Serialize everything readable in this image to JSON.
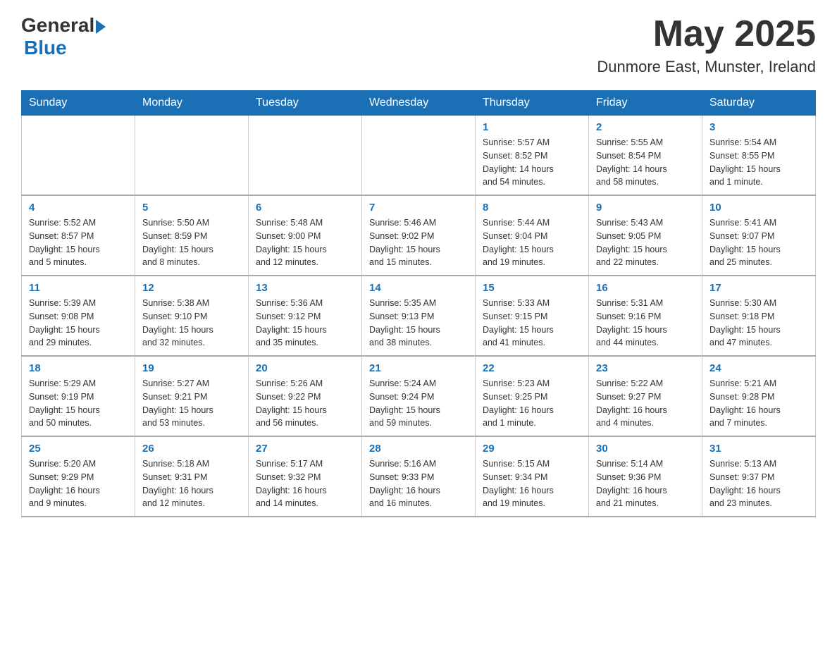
{
  "header": {
    "logo_general": "General",
    "logo_blue": "Blue",
    "month": "May 2025",
    "location": "Dunmore East, Munster, Ireland"
  },
  "weekdays": [
    "Sunday",
    "Monday",
    "Tuesday",
    "Wednesday",
    "Thursday",
    "Friday",
    "Saturday"
  ],
  "weeks": [
    [
      {
        "day": "",
        "info": ""
      },
      {
        "day": "",
        "info": ""
      },
      {
        "day": "",
        "info": ""
      },
      {
        "day": "",
        "info": ""
      },
      {
        "day": "1",
        "info": "Sunrise: 5:57 AM\nSunset: 8:52 PM\nDaylight: 14 hours\nand 54 minutes."
      },
      {
        "day": "2",
        "info": "Sunrise: 5:55 AM\nSunset: 8:54 PM\nDaylight: 14 hours\nand 58 minutes."
      },
      {
        "day": "3",
        "info": "Sunrise: 5:54 AM\nSunset: 8:55 PM\nDaylight: 15 hours\nand 1 minute."
      }
    ],
    [
      {
        "day": "4",
        "info": "Sunrise: 5:52 AM\nSunset: 8:57 PM\nDaylight: 15 hours\nand 5 minutes."
      },
      {
        "day": "5",
        "info": "Sunrise: 5:50 AM\nSunset: 8:59 PM\nDaylight: 15 hours\nand 8 minutes."
      },
      {
        "day": "6",
        "info": "Sunrise: 5:48 AM\nSunset: 9:00 PM\nDaylight: 15 hours\nand 12 minutes."
      },
      {
        "day": "7",
        "info": "Sunrise: 5:46 AM\nSunset: 9:02 PM\nDaylight: 15 hours\nand 15 minutes."
      },
      {
        "day": "8",
        "info": "Sunrise: 5:44 AM\nSunset: 9:04 PM\nDaylight: 15 hours\nand 19 minutes."
      },
      {
        "day": "9",
        "info": "Sunrise: 5:43 AM\nSunset: 9:05 PM\nDaylight: 15 hours\nand 22 minutes."
      },
      {
        "day": "10",
        "info": "Sunrise: 5:41 AM\nSunset: 9:07 PM\nDaylight: 15 hours\nand 25 minutes."
      }
    ],
    [
      {
        "day": "11",
        "info": "Sunrise: 5:39 AM\nSunset: 9:08 PM\nDaylight: 15 hours\nand 29 minutes."
      },
      {
        "day": "12",
        "info": "Sunrise: 5:38 AM\nSunset: 9:10 PM\nDaylight: 15 hours\nand 32 minutes."
      },
      {
        "day": "13",
        "info": "Sunrise: 5:36 AM\nSunset: 9:12 PM\nDaylight: 15 hours\nand 35 minutes."
      },
      {
        "day": "14",
        "info": "Sunrise: 5:35 AM\nSunset: 9:13 PM\nDaylight: 15 hours\nand 38 minutes."
      },
      {
        "day": "15",
        "info": "Sunrise: 5:33 AM\nSunset: 9:15 PM\nDaylight: 15 hours\nand 41 minutes."
      },
      {
        "day": "16",
        "info": "Sunrise: 5:31 AM\nSunset: 9:16 PM\nDaylight: 15 hours\nand 44 minutes."
      },
      {
        "day": "17",
        "info": "Sunrise: 5:30 AM\nSunset: 9:18 PM\nDaylight: 15 hours\nand 47 minutes."
      }
    ],
    [
      {
        "day": "18",
        "info": "Sunrise: 5:29 AM\nSunset: 9:19 PM\nDaylight: 15 hours\nand 50 minutes."
      },
      {
        "day": "19",
        "info": "Sunrise: 5:27 AM\nSunset: 9:21 PM\nDaylight: 15 hours\nand 53 minutes."
      },
      {
        "day": "20",
        "info": "Sunrise: 5:26 AM\nSunset: 9:22 PM\nDaylight: 15 hours\nand 56 minutes."
      },
      {
        "day": "21",
        "info": "Sunrise: 5:24 AM\nSunset: 9:24 PM\nDaylight: 15 hours\nand 59 minutes."
      },
      {
        "day": "22",
        "info": "Sunrise: 5:23 AM\nSunset: 9:25 PM\nDaylight: 16 hours\nand 1 minute."
      },
      {
        "day": "23",
        "info": "Sunrise: 5:22 AM\nSunset: 9:27 PM\nDaylight: 16 hours\nand 4 minutes."
      },
      {
        "day": "24",
        "info": "Sunrise: 5:21 AM\nSunset: 9:28 PM\nDaylight: 16 hours\nand 7 minutes."
      }
    ],
    [
      {
        "day": "25",
        "info": "Sunrise: 5:20 AM\nSunset: 9:29 PM\nDaylight: 16 hours\nand 9 minutes."
      },
      {
        "day": "26",
        "info": "Sunrise: 5:18 AM\nSunset: 9:31 PM\nDaylight: 16 hours\nand 12 minutes."
      },
      {
        "day": "27",
        "info": "Sunrise: 5:17 AM\nSunset: 9:32 PM\nDaylight: 16 hours\nand 14 minutes."
      },
      {
        "day": "28",
        "info": "Sunrise: 5:16 AM\nSunset: 9:33 PM\nDaylight: 16 hours\nand 16 minutes."
      },
      {
        "day": "29",
        "info": "Sunrise: 5:15 AM\nSunset: 9:34 PM\nDaylight: 16 hours\nand 19 minutes."
      },
      {
        "day": "30",
        "info": "Sunrise: 5:14 AM\nSunset: 9:36 PM\nDaylight: 16 hours\nand 21 minutes."
      },
      {
        "day": "31",
        "info": "Sunrise: 5:13 AM\nSunset: 9:37 PM\nDaylight: 16 hours\nand 23 minutes."
      }
    ]
  ]
}
